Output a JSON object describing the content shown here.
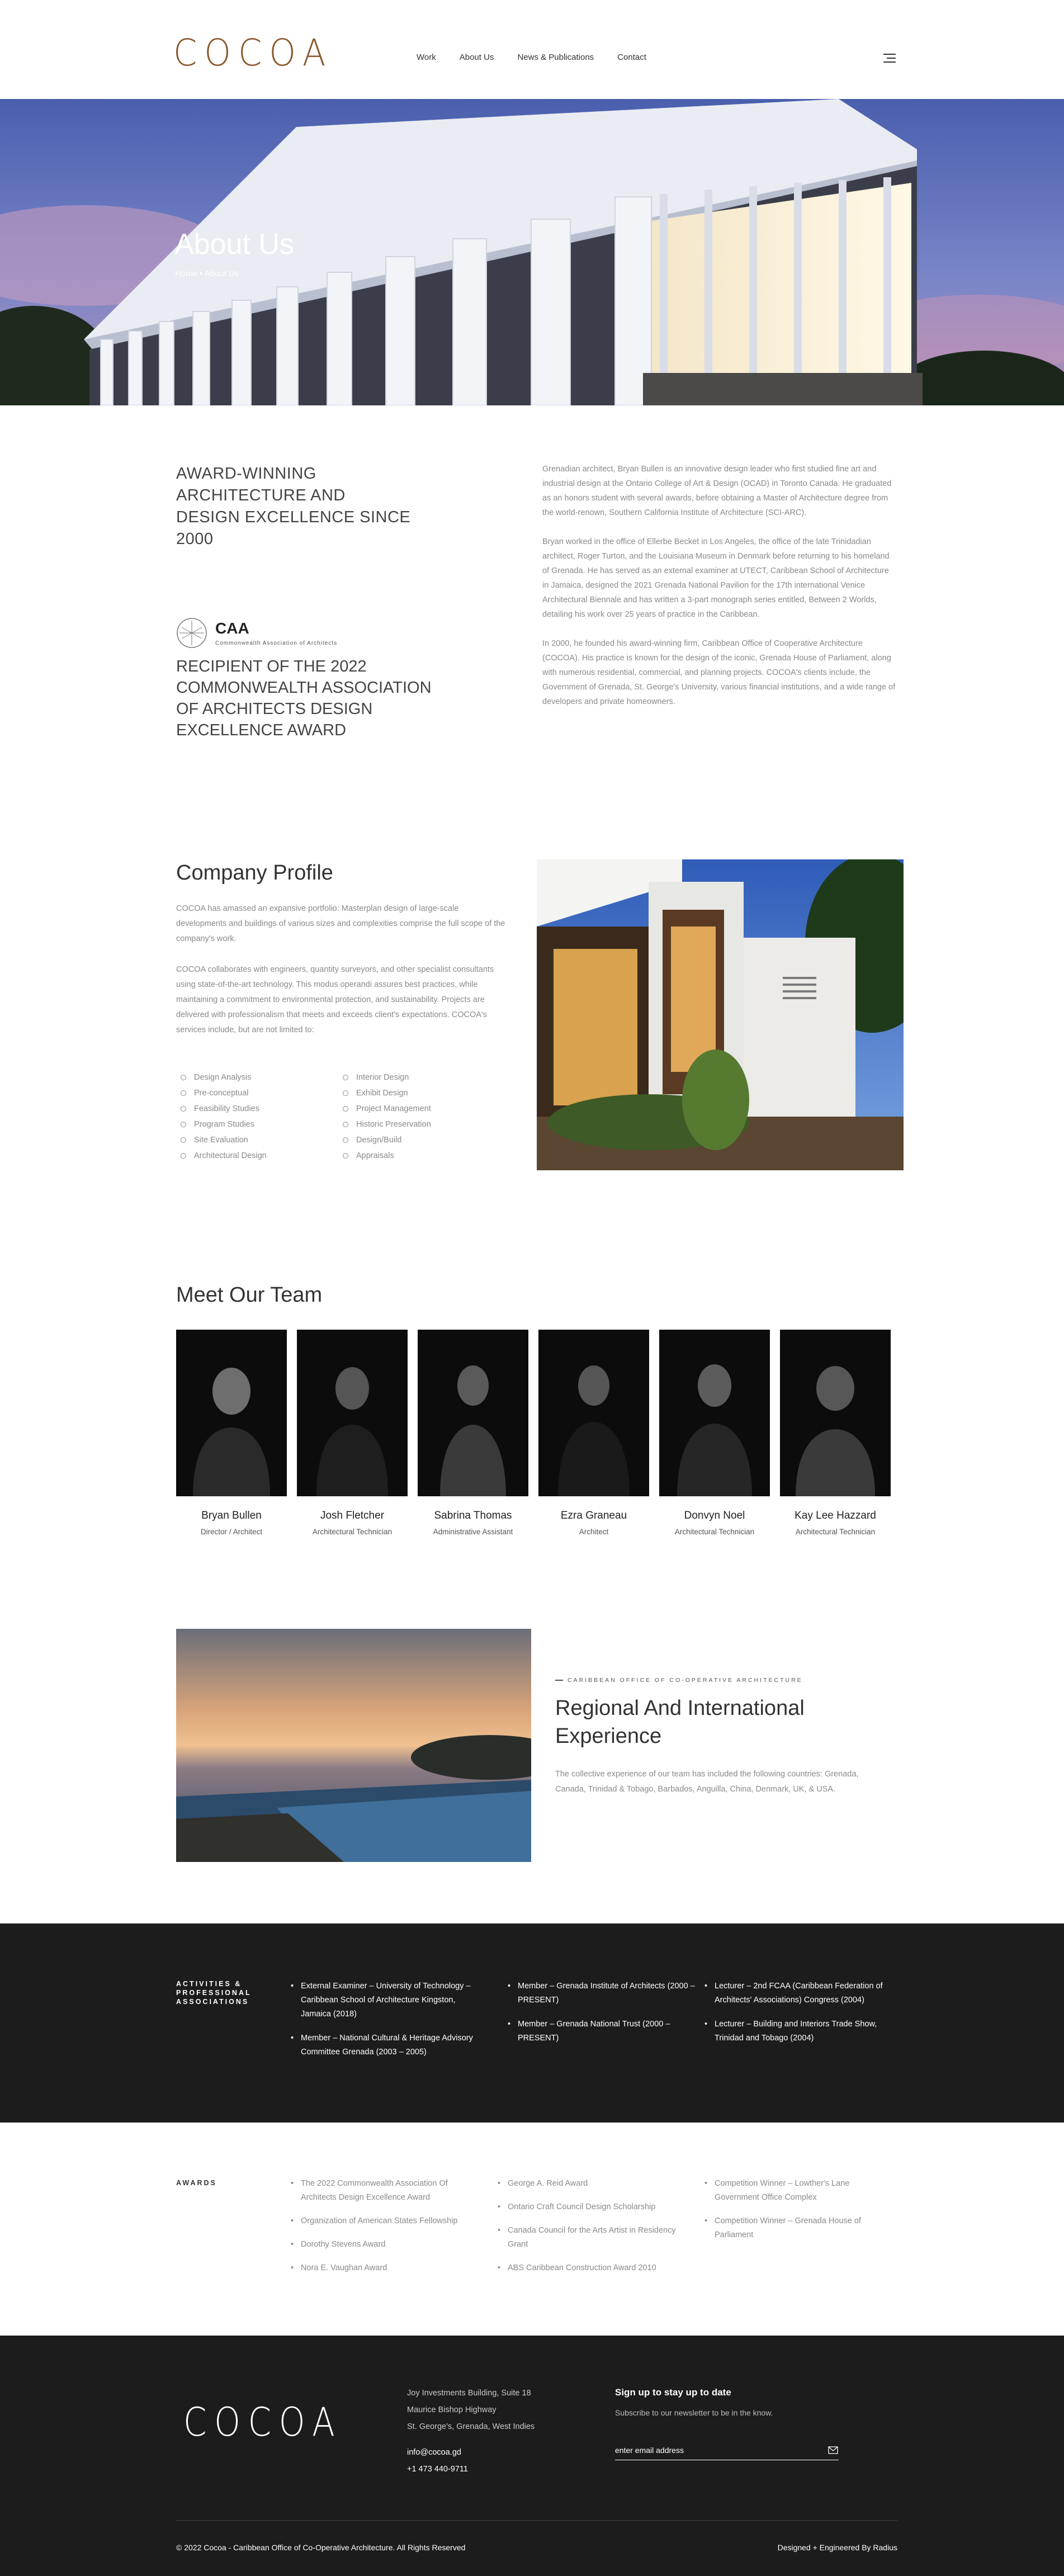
{
  "brand": {
    "logo": "COCOA",
    "accent": "#8a5a2e"
  },
  "nav": {
    "items": [
      "Work",
      "About Us",
      "News & Publications",
      "Contact"
    ],
    "menu_icon": "hamburger-icon"
  },
  "hero": {
    "title": "About Us",
    "breadcrumb": "Home  •  About Us"
  },
  "about": {
    "heading": "AWARD-WINNING ARCHITECTURE AND DESIGN EXCELLENCE SINCE 2000",
    "caa_title": "CAA",
    "caa_subtitle": "Commonwealth Association of Architects",
    "recipient": "RECIPIENT OF THE 2022 COMMONWEALTH ASSOCIATION OF ARCHITECTS DESIGN EXCELLENCE AWARD",
    "paragraphs": [
      "Grenadian architect, Bryan Bullen is an innovative design leader who first studied fine art and industrial design at the Ontario College of Art & Design (OCAD) in Toronto Canada. He graduated as an honors student with several awards, before obtaining a Master of Architecture degree from the world-renown, Southern California Institute of Architecture (SCI-ARC).",
      "Bryan worked in the office of Ellerbe Becket in Los Angeles, the office of the late Trinidadian architect, Roger Turton, and the Louisiana Museum in Denmark before returning to his homeland of Grenada. He has served as an external examiner at UTECT, Caribbean School of Architecture in Jamaica, designed the 2021 Grenada National Pavilion for the 17th international Venice Architectural Biennale and has written a 3-part monograph series entitled, Between 2 Worlds, detailing his work over 25 years of practice in the Caribbean.",
      "In 2000, he founded his award-winning firm, Caribbean Office of Cooperative Architecture (COCOA). His practice is known for the design of the iconic, Grenada House of Parliament, along with numerous residential, commercial, and planning projects. COCOA's clients include, the Government of Grenada, St. George's University, various financial institutions, and a wide range of developers and private homeowners."
    ]
  },
  "profile": {
    "title": "Company Profile",
    "paragraphs": [
      "COCOA has amassed an expansive portfolio: Masterplan design of large-scale developments and buildings of various sizes and complexities comprise the full scope of the company's work.",
      "COCOA collaborates with engineers, quantity surveyors, and other specialist consultants using state-of-the-art technology. This modus operandi assures best practices, while maintaining a commitment to environmental protection, and sustainability. Projects are delivered with professionalism that meets and exceeds client's expectations. COCOA's services include, but are not limited to:"
    ],
    "services": [
      "Design Analysis",
      "Interior Design",
      "Pre-conceptual",
      "Exhibit Design",
      "Feasibility Studies",
      "Project Management",
      "Program Studies",
      "Historic Preservation",
      "Site Evaluation",
      "Design/Build",
      "Architectural Design",
      "Appraisals"
    ]
  },
  "team": {
    "title": "Meet Our Team",
    "members": [
      {
        "name": "Bryan Bullen",
        "role": "Director / Architect"
      },
      {
        "name": "Josh Fletcher",
        "role": "Architectural Technician"
      },
      {
        "name": "Sabrina Thomas",
        "role": "Administrative Assistant"
      },
      {
        "name": "Ezra Graneau",
        "role": "Architect"
      },
      {
        "name": "Donvyn Noel",
        "role": "Architectural Technician"
      },
      {
        "name": "Kay Lee Hazzard",
        "role": "Architectural Technician"
      }
    ]
  },
  "regional": {
    "kicker": "Caribbean Office of Co-Operative Architecture",
    "title": "Regional And International Experience",
    "text": "The collective experience of our team has included the following countries: Grenada, Canada, Trinidad & Tobago, Barbados, Anguilla, China, Denmark, UK, & USA."
  },
  "activities": {
    "label": "Activities & Professional Associations",
    "columns": [
      [
        "External Examiner – University of Technology – Caribbean School of Architecture Kingston, Jamaica (2018)",
        "Member – National Cultural & Heritage Advisory Committee Grenada (2003 – 2005)"
      ],
      [
        "Member – Grenada Institute of Architects (2000 – PRESENT)",
        "Member – Grenada National Trust (2000 – PRESENT)"
      ],
      [
        "Lecturer – 2nd FCAA (Caribbean Federation of Architects' Associations) Congress (2004)",
        "Lecturer – Building and Interiors Trade Show, Trinidad and Tobago (2004)"
      ]
    ]
  },
  "awards": {
    "label": "Awards",
    "columns": [
      [
        "The 2022 Commonwealth Association Of Architects Design Excellence Award",
        "Organization of American States Fellowship",
        "Dorothy Stevens Award",
        "Nora E. Vaughan Award"
      ],
      [
        "George A. Reid Award",
        "Ontario Craft Council Design Scholarship",
        "Canada Council for the Arts Artist in Residency Grant",
        "ABS Caribbean Construction Award 2010"
      ],
      [
        "Competition Winner – Lowther's Lane Government Office Complex",
        "Competition Winner – Grenada House of Parliament"
      ]
    ]
  },
  "footer": {
    "logo": "COCOA",
    "address": [
      "Joy Investments Building, Suite 18",
      "Maurice Bishop Highway",
      "St. George's, Grenada, West Indies"
    ],
    "email": "info@cocoa.gd",
    "phone": "+1 473 440-9711",
    "signup_title": "Sign up to stay up to date",
    "signup_sub": "Subscribe to our newsletter to be in the know.",
    "email_placeholder": "enter email address",
    "copyright": "© 2022 Cocoa - Caribbean Office of Co-Operative Architecture. All Rights Reserved",
    "credit": "Designed + Engineered By Radius"
  }
}
